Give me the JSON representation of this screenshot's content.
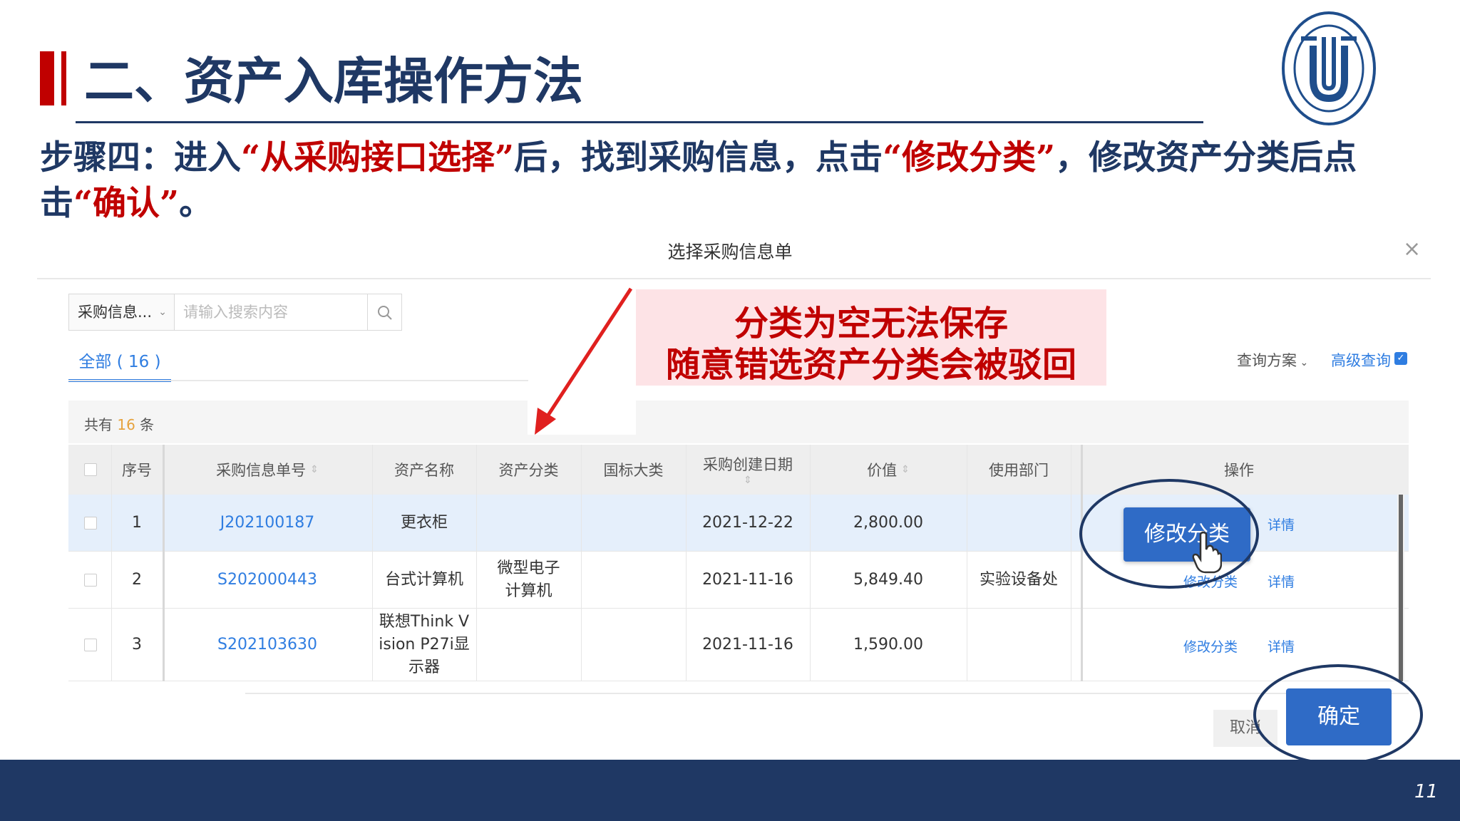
{
  "slide": {
    "title": "二、资产入库操作方法",
    "step_intro": "步骤四：进入",
    "step_q1": "“从采购接口选择”",
    "step_mid1": "后，找到采购信息，点击",
    "step_q2": "“修改分类”",
    "step_mid2": "，修改资产分类后点击",
    "step_q3": "“确认”",
    "step_end": "。",
    "page_number": "11",
    "logo_text": "上海大学 SHANGHAI UNIVERSITY"
  },
  "dialog": {
    "title": "选择采购信息单",
    "close": "×",
    "search": {
      "select_value": "采购信息...",
      "placeholder": "请输入搜索内容"
    },
    "tab_all": "全部 ( 16 )",
    "query_scheme": "查询方案",
    "advanced_query": "高级查询",
    "count_prefix": "共有",
    "count_value": "16",
    "count_suffix": "条",
    "columns": [
      "序号",
      "采购信息单号",
      "资产名称",
      "资产分类",
      "国标大类",
      "采购创建日期",
      "价值",
      "使用部门",
      "操作"
    ],
    "rows": [
      {
        "index": "1",
        "code": "J202100187",
        "name": "更衣柜",
        "category": "",
        "national": "",
        "date": "2021-12-22",
        "value": "2,800.00",
        "dept": "",
        "action_edit": "修改分类",
        "action_detail": "详情"
      },
      {
        "index": "2",
        "code": "S202000443",
        "name": "台式计算机",
        "category": "微型电子计算机",
        "national": "",
        "date": "2021-11-16",
        "value": "5,849.40",
        "dept": "实验设备处",
        "action_edit": "修改分类",
        "action_detail": "详情"
      },
      {
        "index": "3",
        "code": "S202103630",
        "name": "联想Think Vision P27i显示器",
        "category": "",
        "national": "",
        "date": "2021-11-16",
        "value": "1,590.00",
        "dept": "",
        "action_edit": "修改分类",
        "action_detail": "详情"
      }
    ],
    "cancel_label": "取消",
    "ok_label": "确定"
  },
  "annotation": {
    "line1": "分类为空无法保存",
    "line2": "随意错选资产分类会被驳回"
  },
  "colors": {
    "navy": "#1f3864",
    "red": "#c00000",
    "blue": "#2f6bc6",
    "link": "#2f7de1"
  },
  "icons": [
    "search-icon",
    "close-icon",
    "chevron-down-icon",
    "hand-cursor-icon",
    "checkbox-icon",
    "sort-icon"
  ]
}
